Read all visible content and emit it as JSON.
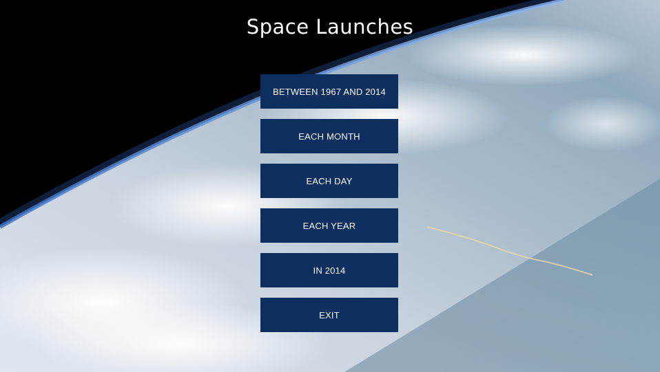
{
  "window": {
    "title": "Space Launches"
  },
  "background": {
    "description_icon": "earth-orbit-image",
    "space_color": "#000000",
    "atmosphere_color": "#5b8fd6"
  },
  "menu": {
    "button_color": "#0d2f5f",
    "items": [
      {
        "label": "BETWEEN 1967 AND 2014"
      },
      {
        "label": "EACH MONTH"
      },
      {
        "label": "EACH DAY"
      },
      {
        "label": "EACH YEAR"
      },
      {
        "label": "IN 2014"
      },
      {
        "label": "EXIT"
      }
    ]
  }
}
